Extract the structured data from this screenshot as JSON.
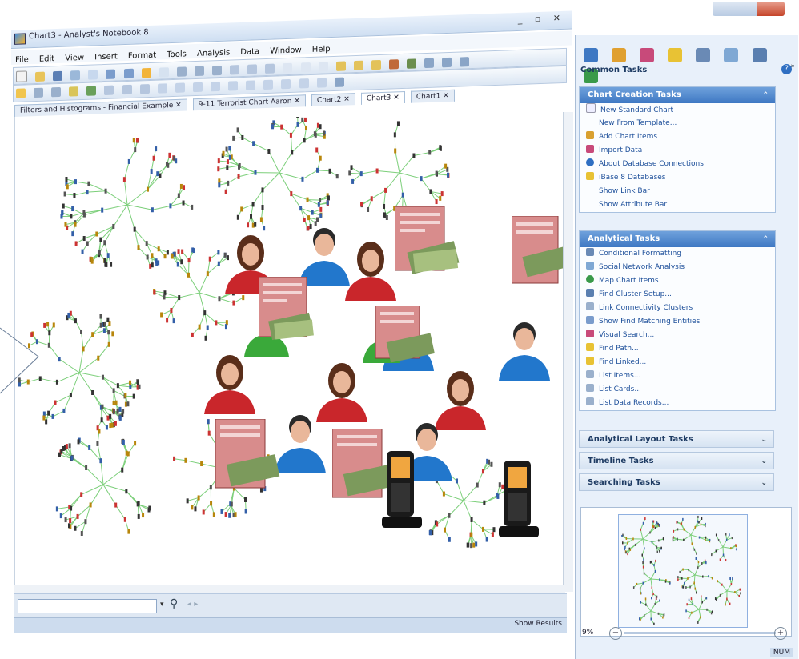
{
  "window": {
    "title": "Chart3 - Analyst's Notebook 8",
    "controls": "_ ▫ ✕"
  },
  "menu": [
    "File",
    "Edit",
    "View",
    "Insert",
    "Format",
    "Tools",
    "Analysis",
    "Data",
    "Window",
    "Help"
  ],
  "tabs": [
    {
      "label": "Filters and Histograms - Financial Example",
      "active": false
    },
    {
      "label": "9-11 Terrorist Chart Aaron",
      "active": false
    },
    {
      "label": "Chart2",
      "active": false
    },
    {
      "label": "Chart3",
      "active": true
    },
    {
      "label": "Chart1",
      "active": false
    }
  ],
  "search": {
    "placeholder": "",
    "value": "",
    "show_results": "Show Results"
  },
  "right_pane": {
    "title": "Common Tasks",
    "help": "?",
    "chart_creation": {
      "header": "Chart Creation Tasks",
      "items": [
        "New Standard Chart",
        "New From Template...",
        "Add Chart Items",
        "Import Data",
        "About Database Connections",
        "iBase 8 Databases",
        "Show Link Bar",
        "Show Attribute Bar"
      ]
    },
    "analytical": {
      "header": "Analytical Tasks",
      "items": [
        "Conditional Formatting",
        "Social Network Analysis",
        "Map Chart Items",
        "Find Cluster Setup...",
        "Link Connectivity Clusters",
        "Show Find Matching Entities",
        "Visual Search...",
        "Find Path...",
        "Find Linked...",
        "List Items...",
        "List Cards...",
        "List Data Records..."
      ]
    },
    "collapsed": [
      "Analytical Layout Tasks",
      "Timeline Tasks",
      "Searching Tasks"
    ]
  },
  "zoom": {
    "label": "9%"
  },
  "status": {
    "num": "NUM"
  },
  "colors": {
    "accent": "#3e78c3",
    "person_red": "#c9262b",
    "person_blue": "#2277cc",
    "person_green": "#3aa93a",
    "card": "#d88c8c"
  }
}
